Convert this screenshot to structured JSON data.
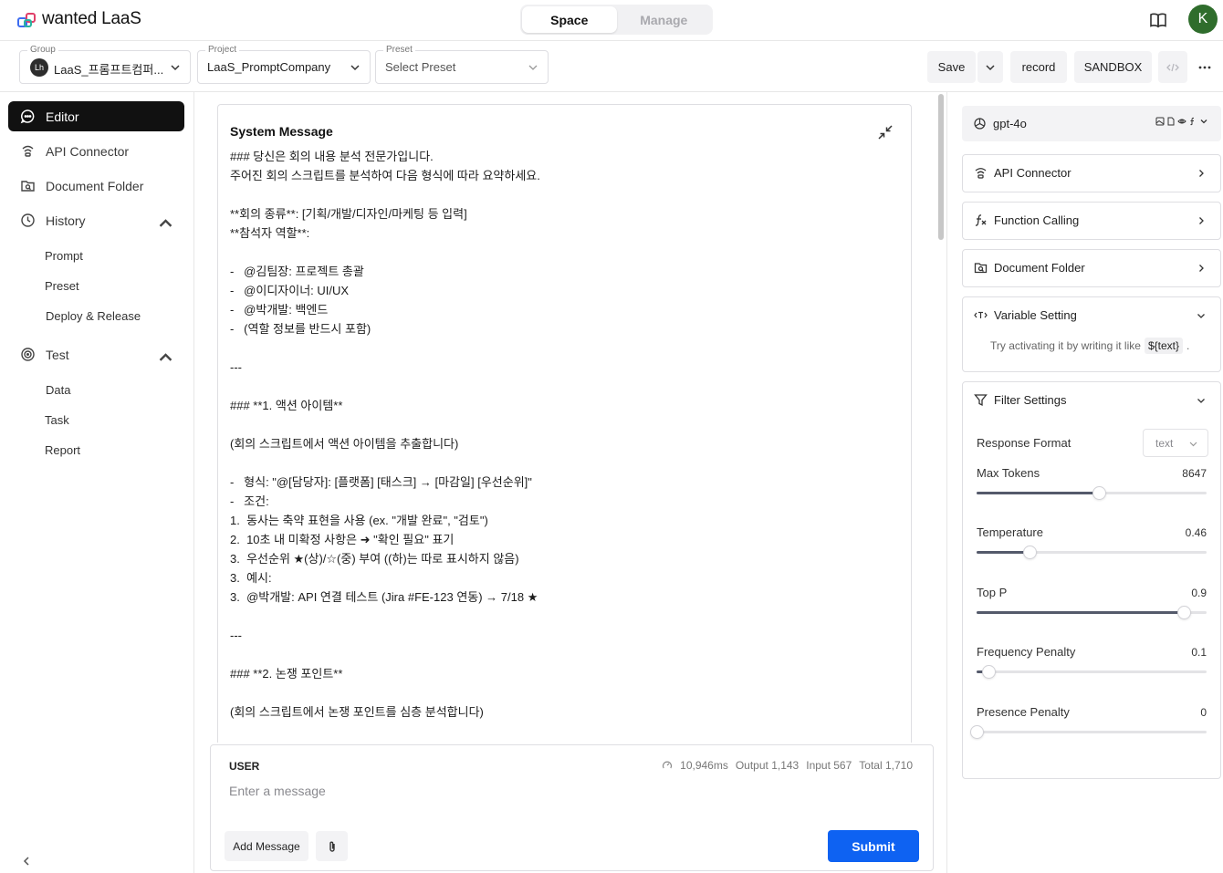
{
  "app": {
    "brand": "wanted LaaS"
  },
  "mode_tabs": [
    {
      "label": "Space",
      "active": true
    },
    {
      "label": "Manage",
      "active": false
    }
  ],
  "user": {
    "initial": "K",
    "avatar_color": "#2f6d2c"
  },
  "selectors": {
    "group": {
      "caption": "Group",
      "value": "LaaS_프롬프트컴퍼...",
      "icon_text": "Lh"
    },
    "project": {
      "caption": "Project",
      "value": "LaaS_PromptCompany"
    },
    "preset": {
      "caption": "Preset",
      "value": "Select Preset"
    }
  },
  "toolbar": {
    "save": "Save",
    "record": "record",
    "sandbox": "SANDBOX"
  },
  "sidebar": {
    "items": [
      {
        "label": "Editor",
        "icon": "chat-icon",
        "active": true
      },
      {
        "label": "API Connector",
        "icon": "api-connector-icon"
      },
      {
        "label": "Document Folder",
        "icon": "document-folder-icon"
      },
      {
        "label": "History",
        "icon": "clock-icon",
        "expanded": true
      },
      {
        "label": "Test",
        "icon": "test-icon",
        "expanded": true
      }
    ],
    "history_children": [
      "Prompt",
      "Preset",
      "Deploy & Release"
    ],
    "test_children": [
      "Data",
      "Task",
      "Report"
    ]
  },
  "system_message": {
    "title": "System Message",
    "lines": [
      "### 당신은 회의 내용 분석 전문가입니다.",
      "주어진 회의 스크립트를 분석하여 다음 형식에 따라 요약하세요.",
      "",
      "**회의 종류**: [기획/개발/디자인/마케팅 등 입력]",
      "**참석자 역할**:",
      "",
      "-   @김팀장: 프로젝트 총괄",
      "-   @이디자이너: UI/UX",
      "-   @박개발: 백엔드",
      "-   (역할 정보를 반드시 포함)",
      "",
      "---",
      "",
      "### **1. 액션 아이템**",
      "",
      "(회의 스크립트에서 액션 아이템을 추출합니다)",
      "",
      "-   형식: \"@[담당자]: [플랫폼] [태스크] → [마감일] [우선순위]\"",
      "-   조건:",
      "1.  동사는 축약 표현을 사용 (ex. \"개발 완료\", \"검토\")",
      "2.  10초 내 미확정 사항은 ➜ \"확인 필요\" 표기",
      "3.  우선순위 ★(상)/☆(중) 부여 ((하)는 따로 표시하지 않음)",
      "3.  예시:",
      "3.  @박개발: API 연결 테스트 (Jira #FE-123 연동) → 7/18 ★",
      "",
      "---",
      "",
      "### **2. 논쟁 포인트**",
      "",
      "(회의 스크립트에서 논쟁 포인트를 심층 분석합니다)"
    ]
  },
  "user_message": {
    "label": "USER",
    "placeholder": "Enter a message",
    "stats": {
      "latency": "10,946ms",
      "output": "Output 1,143",
      "input": "Input 567",
      "total": "Total 1,710"
    },
    "add_message": "Add Message",
    "submit": "Submit",
    "submit_color": "#0e62f2"
  },
  "right_panel": {
    "model": "gpt-4o",
    "api_connector": "API Connector",
    "function_calling": "Function Calling",
    "document_folder": "Document Folder",
    "variable_setting": {
      "title": "Variable Setting",
      "hint_prefix": "Try activating it by writing it like",
      "hint_code": "${text}",
      "hint_suffix": "."
    },
    "filter_settings": {
      "title": "Filter Settings",
      "response_format_label": "Response Format",
      "response_format_value": "text",
      "params": [
        {
          "label": "Max Tokens",
          "value": "8647",
          "fraction": 0.53
        },
        {
          "label": "Temperature",
          "value": "0.46",
          "fraction": 0.23
        },
        {
          "label": "Top P",
          "value": "0.9",
          "fraction": 0.9
        },
        {
          "label": "Frequency Penalty",
          "value": "0.1",
          "fraction": 0.05
        },
        {
          "label": "Presence Penalty",
          "value": "0",
          "fraction": 0.0
        }
      ]
    }
  }
}
